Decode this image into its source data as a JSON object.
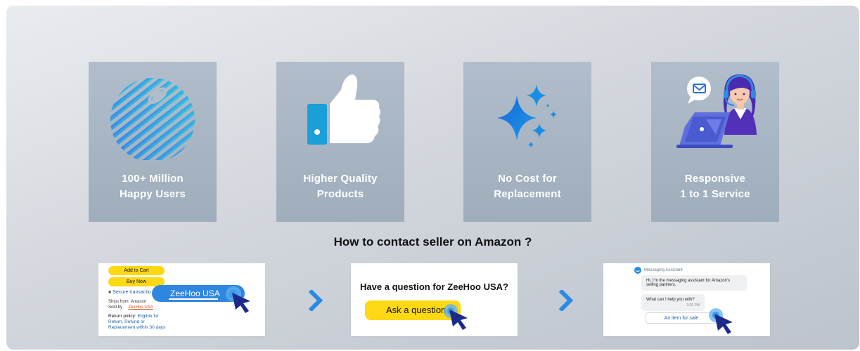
{
  "features": [
    {
      "icon": "striped-globe-icon",
      "line1": "100+ Million",
      "line2": "Happy Users"
    },
    {
      "icon": "thumbs-up-icon",
      "line1": "Higher Quality",
      "line2": "Products"
    },
    {
      "icon": "sparkles-icon",
      "line1": "No Cost for",
      "line2": "Replacement"
    },
    {
      "icon": "support-agent-icon",
      "line1": "Responsive",
      "line2": "1 to 1 Service"
    }
  ],
  "how_to": {
    "title": "How to contact seller on Amazon ?",
    "step1": {
      "add_to_cart": "Add to Cart",
      "buy_now": "Buy Now",
      "secure": "Secure transactio",
      "ships_from_label": "Ships from",
      "ships_from_value": "Amazon",
      "sold_by_label": "Sold by",
      "sold_by_value": "ZeeHoo USA",
      "return_policy_label": "Return policy:",
      "return_policy_text1": "Eligible for",
      "return_policy_text2": "Return, Refund or",
      "return_policy_text3": "Replacement within 30 days",
      "seller_bubble": "ZeeHoo USA"
    },
    "step2": {
      "question": "Have a question for ZeeHoo USA?",
      "button": "Ask a question"
    },
    "step3": {
      "header": "Messaging Assistant",
      "msg1": "Hi, I'm the messaging assistant for Amazon's selling partners.",
      "msg2": "What can I help you with?",
      "time": "3:20 PM",
      "chip": "An item for sale"
    }
  },
  "colors": {
    "amazon_yellow": "#ffd814",
    "accent_blue": "#2f86e0",
    "arrow_blue": "#2a8be6",
    "cursor_navy": "#1d2a8c"
  }
}
